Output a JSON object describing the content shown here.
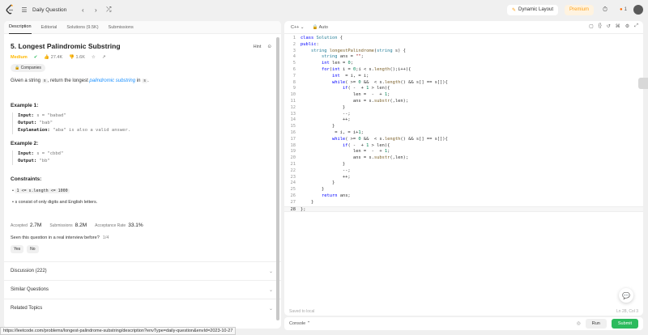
{
  "nav": {
    "title": "Daily Question",
    "dynamic_layout": "Dynamic Layout",
    "premium": "Premium",
    "streak": "1"
  },
  "tabs": [
    "Description",
    "Editorial",
    "Solutions (9.5K)",
    "Submissions"
  ],
  "problem": {
    "title": "5. Longest Palindromic Substring",
    "hint": "Hint",
    "difficulty": "Medium",
    "likes": "27.4K",
    "dislikes": "1.6K",
    "tag": "Companies",
    "desc_pre": "Given a string ",
    "desc_code": "s",
    "desc_mid": ", return the longest ",
    "desc_link": "palindromic substring",
    "desc_in": " in ",
    "desc_code2": "s",
    "desc_end": "."
  },
  "examples": [
    {
      "title": "Example 1:",
      "input_label": "Input:",
      "input": "s = \"babad\"",
      "output_label": "Output:",
      "output": "\"bab\"",
      "expl_label": "Explanation:",
      "explanation": "\"aba\" is also a valid answer."
    },
    {
      "title": "Example 2:",
      "input_label": "Input:",
      "input": "s = \"cbbd\"",
      "output_label": "Output:",
      "output": "\"bb\""
    }
  ],
  "constraints": {
    "title": "Constraints:",
    "items": [
      "1 <= s.length <= 1000",
      "s consist of only digits and English letters."
    ]
  },
  "stats": {
    "accepted_label": "Accepted",
    "accepted": "2.7M",
    "submissions_label": "Submissions",
    "submissions": "8.2M",
    "rate_label": "Acceptance Rate",
    "rate": "33.1%"
  },
  "seen": {
    "question": "Seen this question in a real interview before?",
    "count": "1/4",
    "yes": "Yes",
    "no": "No"
  },
  "accordions": [
    "Discussion (222)",
    "Similar Questions",
    "Related Topics"
  ],
  "status_url": "https://leetcode.com/problems/longest-palindrome-substring/description?envType=daily-question&envId=2023-10-27",
  "editor": {
    "language": "C++",
    "mode": "Auto",
    "saved": "Saved to local",
    "cursor": "Ln 28, Col 3"
  },
  "code_lines": [
    "class Solution {",
    "public:",
    "    string longestPalindrome(string s) {",
    "        string ans = \"\";",
    "        int len = 0;",
    "        for(int i = 0;i < s.length();i++){",
    "            int p1 = i,p2 = i;",
    "            while(p1 >= 0 && p2 < s.length() && s[p1] == s[p2]){",
    "                if(p2 - p1 + 1 > len){",
    "                    len = p2 - p1 + 1;",
    "                    ans = s.substr(p1,len);",
    "                }",
    "                p1--;",
    "                p2++;",
    "            }",
    "            p1 = i,p2 = i+1;",
    "            while(p1 >= 0 && p2 < s.length() && s[p1] == s[p2]){",
    "                if(p2 - p1 + 1 > len){",
    "                    len = p2 - p1 + 1;",
    "                    ans = s.substr(p1,len);",
    "                }",
    "                p1--;",
    "                p2++;",
    "            }",
    "        }",
    "        return ans;",
    "    }",
    "};"
  ],
  "actions": {
    "console": "Console",
    "run": "Run",
    "submit": "Submit"
  }
}
